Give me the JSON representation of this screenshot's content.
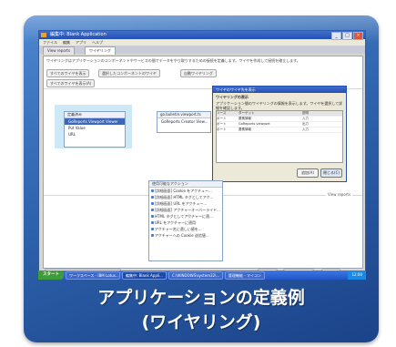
{
  "caption": {
    "line1": "アプリケーションの定義例",
    "line2": "(ワイヤリング)"
  },
  "window": {
    "title": "編集中: Blank Application",
    "controls": [
      "_",
      "□",
      "×"
    ],
    "menus": [
      "ファイル",
      "編集",
      "アプリ",
      "ヘルプ"
    ],
    "tabs": [
      "View reports",
      "ワイヤリング"
    ],
    "description": "ワイヤリングはアプリケーションのコンポーネントやサービスの間でデータをやり取りするための接続を定義します。ワイヤを作成して接続を確立します。",
    "toolbar_buttons": [
      "すべてのワイヤを表示",
      "選択したコンポーネントのワイヤ",
      "自動ワイヤリング"
    ],
    "select_button": "すべてのワイヤを表示(A)",
    "node_left": {
      "header": "定義済み",
      "items": [
        "GoReports Viewport Viewer",
        "Put Value",
        "URL"
      ]
    },
    "node_right": {
      "header": "go.bulletin.viewport.ts",
      "items": [
        "GoReports Creator View..."
      ]
    },
    "view_reports_label": "View reports",
    "status_buttons": [
      "設定をクリアしてシステムの既定に戻す(I)",
      "次へ(N)",
      "キャンセル(C)",
      "完了(F)"
    ]
  },
  "dialog": {
    "title": "ワイヤのワイヤ先を表示",
    "heading": "ワイヤリングの表示",
    "text": "アプリケーション間のワイヤリングの情報を表示します。ワイヤを選択して詳細を確認します。",
    "columns": [
      "ソース",
      "ターゲット",
      "説明"
    ],
    "rows": [
      [
        "ポート",
        "要素情報",
        "入力"
      ],
      [
        "ポート",
        "GoReports viewport",
        "出力"
      ],
      [
        "ポート",
        "要素情報",
        "入力"
      ]
    ],
    "buttons": [
      "追加(A)",
      "閉じる(C)"
    ]
  },
  "palette": {
    "title": "使用可能なアクション",
    "items": [
      "[詳細画面] Cookie をアクチュー...",
      "[詳細画面] HTML タグとしてアク...",
      "[詳細画面] URL をアクチュー...",
      "[詳細画面] アクチャーオーバーライド...",
      "HTML タグとしてアクチャーに適...",
      "URL をアクチャーに適用",
      "アクチャー名に適しい値を...",
      "アクチャーへの Cookie 送信値..."
    ]
  },
  "taskbar": {
    "start": "スタート",
    "tasks": [
      "ワークスペース - IBM Lotus...",
      "編集中: Blank Appli...",
      "C:\\WINDOWS\\system32\\...",
      "管理機能 - マイコン"
    ],
    "tray": "12:00"
  }
}
